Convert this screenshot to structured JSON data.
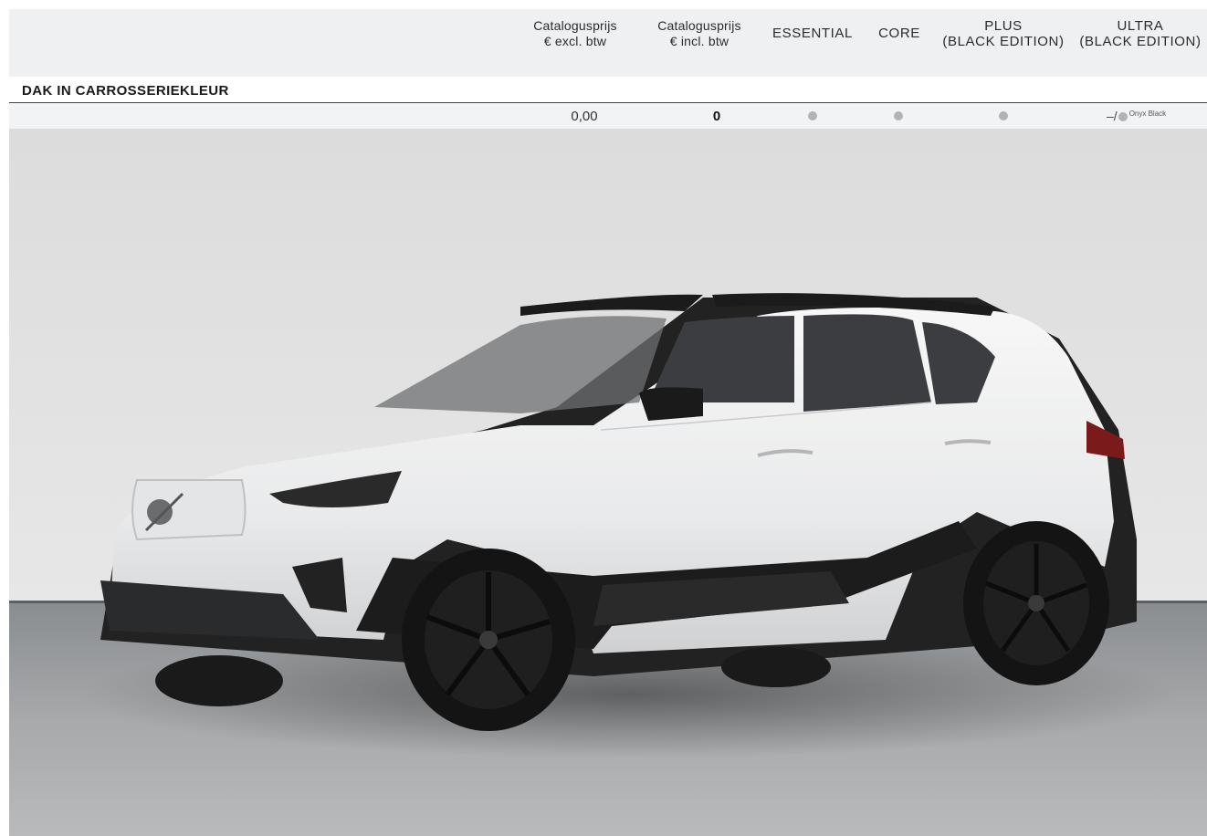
{
  "header": {
    "col1": {
      "line1": "Catalogusprijs",
      "line2": "€ excl. btw"
    },
    "col2": {
      "line1": "Catalogusprijs",
      "line2": "€ incl. btw"
    },
    "col3": {
      "line1": "ESSENTIAL"
    },
    "col4": {
      "line1": "CORE"
    },
    "col5": {
      "line1": "PLUS",
      "line2": "(BLACK EDITION)"
    },
    "col6": {
      "line1": "ULTRA",
      "line2": "(BLACK EDITION)"
    }
  },
  "section": {
    "title": "DAK IN CARROSSERIEKLEUR",
    "row": {
      "price_excl": "0,00",
      "price_incl": "0",
      "essential": "standard",
      "core": "standard",
      "plus": "standard",
      "ultra_prefix": "–/",
      "ultra_note": "Onyx Black"
    }
  },
  "image": {
    "subject": "car-photo"
  },
  "colors": {
    "header_bg": "#eef0f2",
    "row_bg": "#f2f3f4",
    "dot": "#b3b3b3"
  }
}
